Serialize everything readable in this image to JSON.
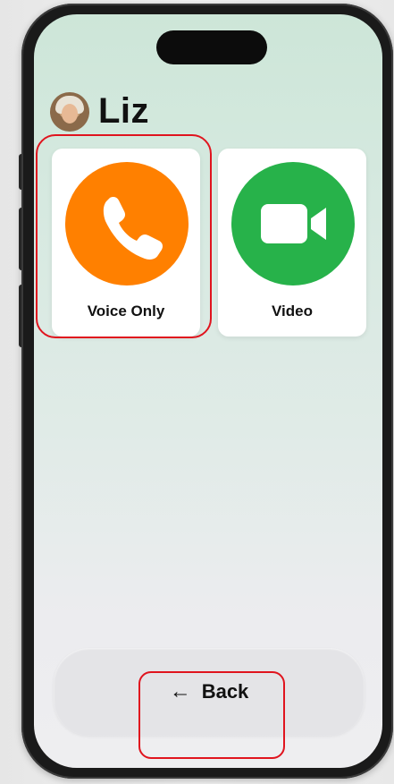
{
  "contact": {
    "name": "Liz"
  },
  "call_options": [
    {
      "label": "Voice Only",
      "icon": "phone-icon",
      "color": "#ff8000"
    },
    {
      "label": "Video",
      "icon": "video-camera-icon",
      "color": "#27b24a"
    }
  ],
  "navigation": {
    "back_label": "Back",
    "back_icon": "arrow-left-icon"
  },
  "annotations": {
    "highlight_color": "#e0141e"
  }
}
